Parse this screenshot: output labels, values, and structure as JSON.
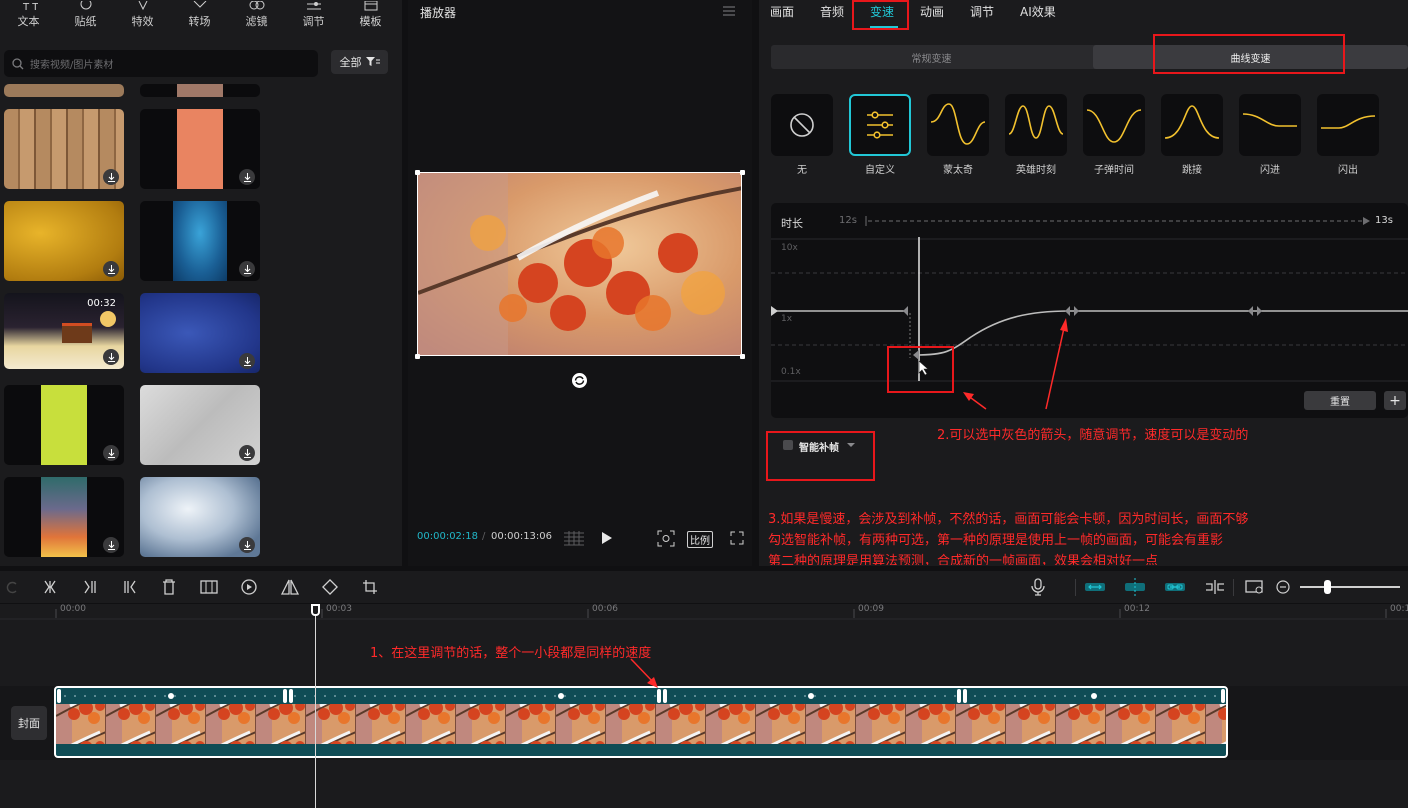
{
  "left_panel": {
    "toolbar": [
      "文本",
      "贴纸",
      "特效",
      "转场",
      "滤镜",
      "调节",
      "模板"
    ],
    "search_placeholder": "搜索视频/图片素材",
    "filter_label": "全部",
    "thumb_duration": "00:32"
  },
  "player": {
    "title": "播放器",
    "current_time": "00:00:02:18",
    "total_time": "00:00:13:06",
    "ratio_label": "比例"
  },
  "right_panel": {
    "tabs": [
      "画面",
      "音频",
      "变速",
      "动画",
      "调节",
      "AI效果"
    ],
    "active_tab": "变速",
    "speed_modes": [
      "常规变速",
      "曲线变速"
    ],
    "presets": [
      "无",
      "自定义",
      "蒙太奇",
      "英雄时刻",
      "子弹时间",
      "跳接",
      "闪进",
      "闪出"
    ],
    "curve": {
      "duration_label": "时长",
      "from": "12s",
      "to": "13s",
      "y_labels": [
        "10x",
        "1x",
        "0.1x"
      ],
      "reset_label": "重置",
      "add_label": "+"
    },
    "smart_frame_label": "智能补帧"
  },
  "annotations": {
    "a1": "1、在这里调节的话，整个一小段都是同样的速度",
    "a2": "2.可以选中灰色的箭头，随意调节，速度可以是变动的",
    "a3_line1": "3.如果是慢速，会涉及到补帧，不然的话，画面可能会卡顿，因为时间长，画面不够",
    "a3_line2": "勾选智能补帧，有两种可选，第一种的原理是使用上一帧的画面，可能会有重影",
    "a3_line3": "第二种的原理是用算法预测，合成新的一帧画面，效果会相对好一点"
  },
  "timeline": {
    "ticks": [
      "00:00",
      "00:03",
      "00:06",
      "00:09",
      "00:12",
      "00:1"
    ],
    "cover_label": "封面"
  },
  "colors": {
    "accent": "#22c7d6",
    "annotation_red": "#ff2a2a",
    "curve_yellow": "#f2c12e",
    "clip_teal": "#0f4c55"
  }
}
